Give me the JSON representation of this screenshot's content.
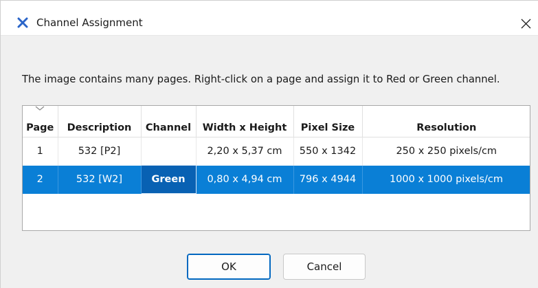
{
  "window": {
    "title": "Channel Assignment",
    "close_label": "Close"
  },
  "instruction": "The image contains many pages. Right-click on a page and assign it to Red or Green channel.",
  "table": {
    "columns": [
      "Page",
      "Description",
      "Channel",
      "Width x Height",
      "Pixel Size",
      "Resolution"
    ],
    "rows": [
      {
        "page": "1",
        "description": "532 [P2]",
        "channel": "",
        "width_height": "2,20 x 5,37 cm",
        "pixel_size": "550 x 1342",
        "resolution": "250 x 250 pixels/cm",
        "selected": false
      },
      {
        "page": "2",
        "description": "532 [W2]",
        "channel": "Green",
        "width_height": "0,80 x 4,94 cm",
        "pixel_size": "796 x 4944",
        "resolution": "1000 x 1000 pixels/cm",
        "selected": true
      }
    ]
  },
  "buttons": {
    "ok": "OK",
    "cancel": "Cancel"
  },
  "colors": {
    "selection": "#0a7fd6",
    "selected_channel_cell": "#0861b3",
    "ok_border": "#0067c0",
    "app_icon": "#2a64c8"
  }
}
